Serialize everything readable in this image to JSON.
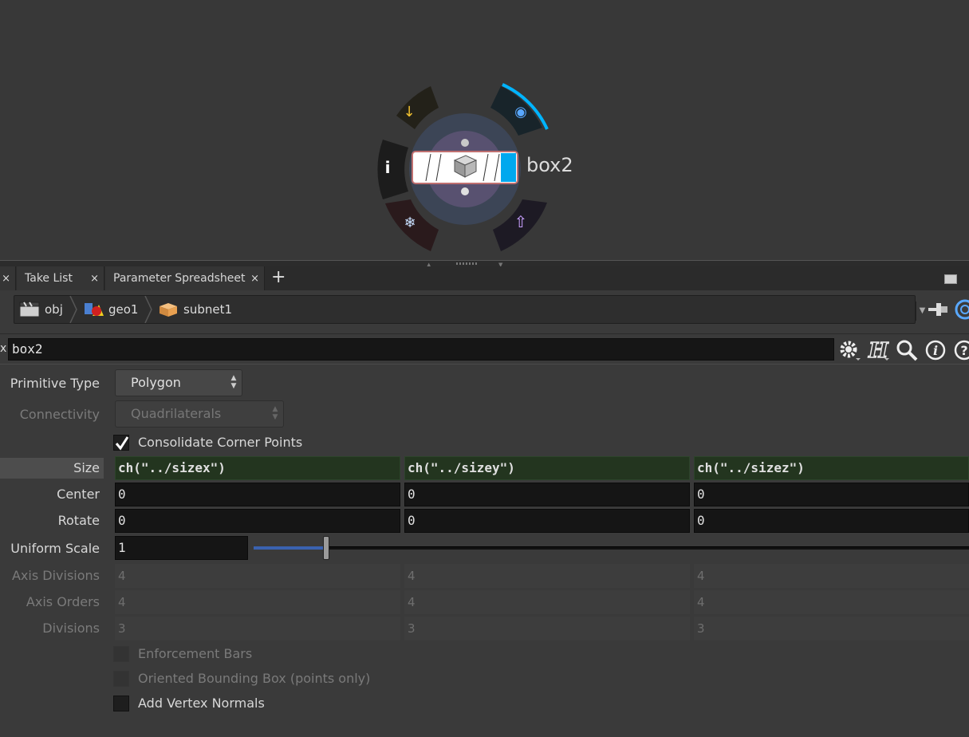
{
  "node": {
    "name": "box2"
  },
  "tabs": [
    {
      "label": ""
    },
    {
      "label": "Take List"
    },
    {
      "label": "Parameter Spreadsheet"
    }
  ],
  "tab_close": "×",
  "tab_add": "+",
  "path": {
    "crumbs": [
      {
        "label": "obj"
      },
      {
        "label": "geo1"
      },
      {
        "label": "subnet1"
      }
    ]
  },
  "name_field": {
    "label": "x",
    "value": "box2"
  },
  "parms": {
    "primitive_type": {
      "label": "Primitive Type",
      "value": "Polygon"
    },
    "connectivity": {
      "label": "Connectivity",
      "value": "Quadrilaterals"
    },
    "consolidate": {
      "label": "Consolidate Corner Points",
      "checked": true
    },
    "size": {
      "label": "Size",
      "values": [
        "ch(\"../sizex\")",
        "ch(\"../sizey\")",
        "ch(\"../sizez\")"
      ]
    },
    "center": {
      "label": "Center",
      "values": [
        "0",
        "0",
        "0"
      ]
    },
    "rotate": {
      "label": "Rotate",
      "values": [
        "0",
        "0",
        "0"
      ]
    },
    "uniform_scale": {
      "label": "Uniform Scale",
      "value": "1",
      "slider_fraction": 0.1
    },
    "axis_divisions": {
      "label": "Axis Divisions",
      "values": [
        "4",
        "4",
        "4"
      ]
    },
    "axis_orders": {
      "label": "Axis Orders",
      "values": [
        "4",
        "4",
        "4"
      ]
    },
    "divisions": {
      "label": "Divisions",
      "values": [
        "3",
        "3",
        "3"
      ]
    },
    "enforcement_bars": {
      "label": "Enforcement Bars",
      "checked": false
    },
    "oriented_bbox": {
      "label": "Oriented Bounding Box (points only)",
      "checked": false
    },
    "add_vertex_normals": {
      "label": "Add Vertex Normals",
      "checked": false
    }
  },
  "colors": {
    "display_flag": "#00b4ff",
    "expr_bg": "#23351f",
    "slider": "#3a62b0"
  }
}
